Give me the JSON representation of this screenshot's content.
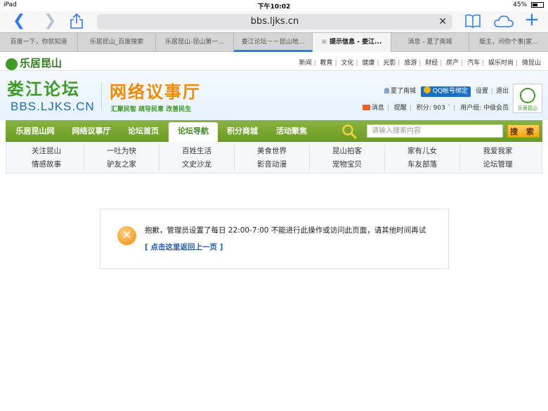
{
  "statusbar": {
    "device": "iPad",
    "time": "下午10:02",
    "battery": "45%"
  },
  "browser": {
    "url": "bbs.ljks.cn",
    "tabs": [
      {
        "label": "百度一下，你就知道"
      },
      {
        "label": "乐居昆山_百度搜索"
      },
      {
        "label": "乐居昆山-昆山第一..."
      },
      {
        "label": "娄江论坛－－昆山地..."
      },
      {
        "label": "提示信息 - 娄江..."
      },
      {
        "label": "消息 - 夏了南城"
      },
      {
        "label": "版主，问你个事|家..."
      }
    ]
  },
  "site": {
    "small_logo": "乐居昆山",
    "top_links": [
      "新闻",
      "教育",
      "文化",
      "健康",
      "光影",
      "旅游",
      "财经",
      "房产",
      "汽车",
      "娱乐时尚",
      "微昆山"
    ],
    "logo_forum": "娄江论坛",
    "logo_domain": "BBS.LJKS.CN",
    "logo_title": "网络议事厅",
    "logo_slogan": "汇聚民智  疏导民意  改善民生",
    "avatar_text": "乐居昆山"
  },
  "user": {
    "name": "夏了南城",
    "qq_bind": "QQ帐号绑定",
    "settings": "设置",
    "logout": "退出",
    "messages": "消息",
    "reminders": "提醒",
    "points": "积分: 903",
    "group": "用户组: 中级会员"
  },
  "nav": {
    "items": [
      {
        "label": "乐居昆山网"
      },
      {
        "label": "网络议事厅"
      },
      {
        "label": "论坛首页"
      },
      {
        "label": "论坛导航"
      },
      {
        "label": "积分商城"
      },
      {
        "label": "活动聚焦"
      }
    ],
    "search_placeholder": "请输入搜索内容",
    "search_button": "搜 索"
  },
  "subnav": {
    "columns": [
      [
        "关注昆山",
        "情感故事"
      ],
      [
        "一吐为快",
        "驴友之家"
      ],
      [
        "百姓生活",
        "文史沙龙"
      ],
      [
        "美食世界",
        "影音动漫"
      ],
      [
        "昆山拍客",
        "宠物宝贝"
      ],
      [
        "家有儿女",
        "车友部落"
      ],
      [
        "我爱我家",
        "论坛管理"
      ]
    ]
  },
  "message": {
    "text": "抱歉，管理员设置了每日 22:00-7:00 不能进行此操作或访问此页面，请其他时间再试",
    "back_link": "[ 点击这里返回上一页 ]"
  },
  "colors": {
    "nav_green": "#7aa830",
    "accent_orange": "#f08a00",
    "link_blue": "#1a5ab0"
  }
}
